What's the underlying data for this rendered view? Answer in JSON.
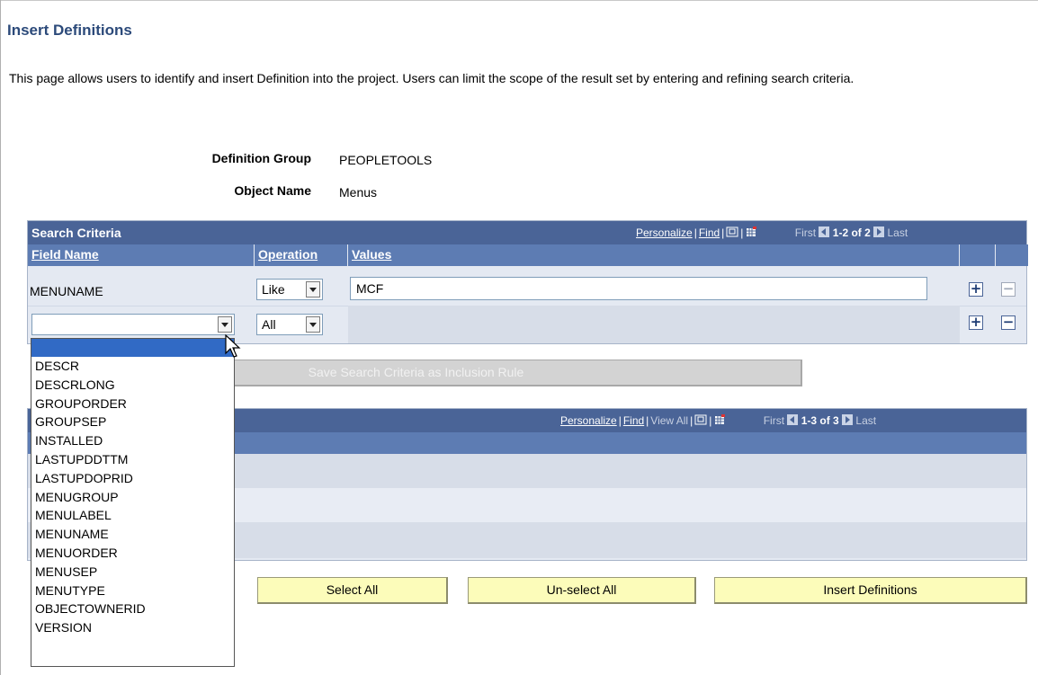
{
  "page": {
    "title": "Insert Definitions",
    "intro": "This page allows users to identify and insert Definition into the project. Users can limit the scope of the result set by entering and refining search criteria."
  },
  "info": {
    "definition_group_label": "Definition Group",
    "definition_group_value": "PEOPLETOOLS",
    "object_name_label": "Object Name",
    "object_name_value": "Menus"
  },
  "search_grid": {
    "title": "Search Criteria",
    "personalize": "Personalize",
    "find": "Find",
    "first": "First",
    "range": "1-2 of 2",
    "last": "Last",
    "columns": [
      "Field Name",
      "Operation",
      "Values"
    ],
    "rows": [
      {
        "field": "MENUNAME",
        "operation": "Like",
        "value": "MCF"
      },
      {
        "field": "",
        "operation": "All",
        "value": ""
      }
    ]
  },
  "save_button": "Save Search Criteria as Inclusion Rule",
  "results_grid": {
    "personalize": "Personalize",
    "find": "Find",
    "view_all": "View All",
    "first": "First",
    "range": "1-3 of 3",
    "last": "Last"
  },
  "buttons": {
    "select_all": "Select All",
    "unselect_all": "Un-select All",
    "insert_definitions": "Insert Definitions"
  },
  "field_dropdown": {
    "options": [
      "DESCR",
      "DESCRLONG",
      "GROUPORDER",
      "GROUPSEP",
      "INSTALLED",
      "LASTUPDDTTM",
      "LASTUPDOPRID",
      "MENUGROUP",
      "MENULABEL",
      "MENUNAME",
      "MENUORDER",
      "MENUSEP",
      "MENUTYPE",
      "OBJECTOWNERID",
      "VERSION"
    ]
  },
  "colors": {
    "header_bg": "#4a6497",
    "column_bg": "#5d7cb3",
    "grid_bg": "#e4e9f2",
    "button_bg": "#fcfcba",
    "title_color": "#2c4a7a",
    "selection": "#316ac5"
  }
}
